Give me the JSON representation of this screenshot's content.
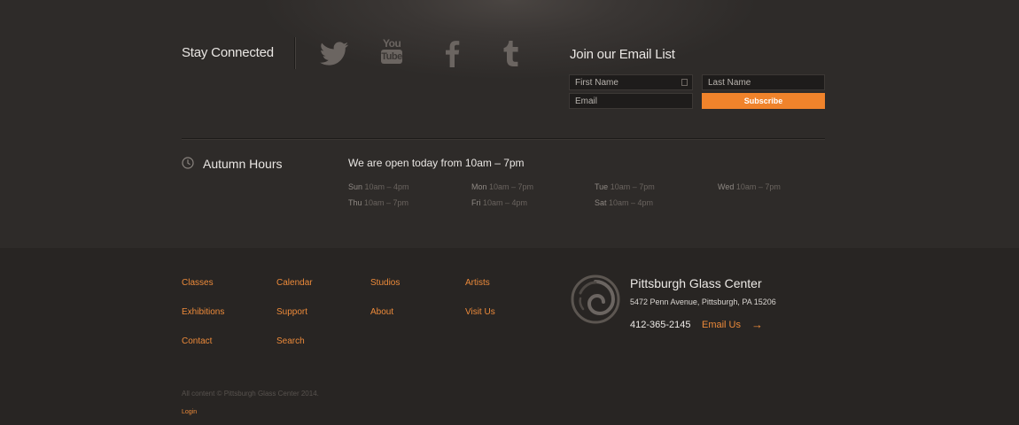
{
  "social": {
    "title": "Stay Connected",
    "icons": [
      "twitter-icon",
      "youtube-icon",
      "facebook-icon",
      "tumblr-icon"
    ],
    "youtube_text": [
      "You",
      "Tube"
    ]
  },
  "email_list": {
    "title": "Join our Email List",
    "first_name_placeholder": "First Name",
    "last_name_placeholder": "Last Name",
    "email_placeholder": "Email",
    "subscribe_label": "Subscribe"
  },
  "hours": {
    "title": "Autumn Hours",
    "today": "We are open today from 10am – 7pm",
    "days": [
      {
        "day": "Sun",
        "time": "10am – 4pm"
      },
      {
        "day": "Mon",
        "time": "10am – 7pm"
      },
      {
        "day": "Tue",
        "time": "10am – 7pm"
      },
      {
        "day": "Wed",
        "time": "10am – 7pm"
      },
      {
        "day": "Thu",
        "time": "10am – 7pm"
      },
      {
        "day": "Fri",
        "time": "10am – 4pm"
      },
      {
        "day": "Sat",
        "time": "10am – 4pm"
      }
    ]
  },
  "footer_nav": [
    "Classes",
    "Calendar",
    "Studios",
    "Artists",
    "Exhibitions",
    "Support",
    "About",
    "Visit Us",
    "Contact",
    "Search"
  ],
  "org": {
    "name": "Pittsburgh Glass Center",
    "address": "5472 Penn Avenue, Pittsburgh, PA 15206",
    "phone": "412-365-2145",
    "email_label": "Email Us",
    "arrow": "→"
  },
  "copyright": "All content © Pittsburgh Glass Center 2014.",
  "login_label": "Login",
  "colors": {
    "accent": "#f0832b",
    "link": "#ec8a3a",
    "background": "#2f2c2a",
    "footer_background": "#282523",
    "icon": "#6b6561"
  }
}
